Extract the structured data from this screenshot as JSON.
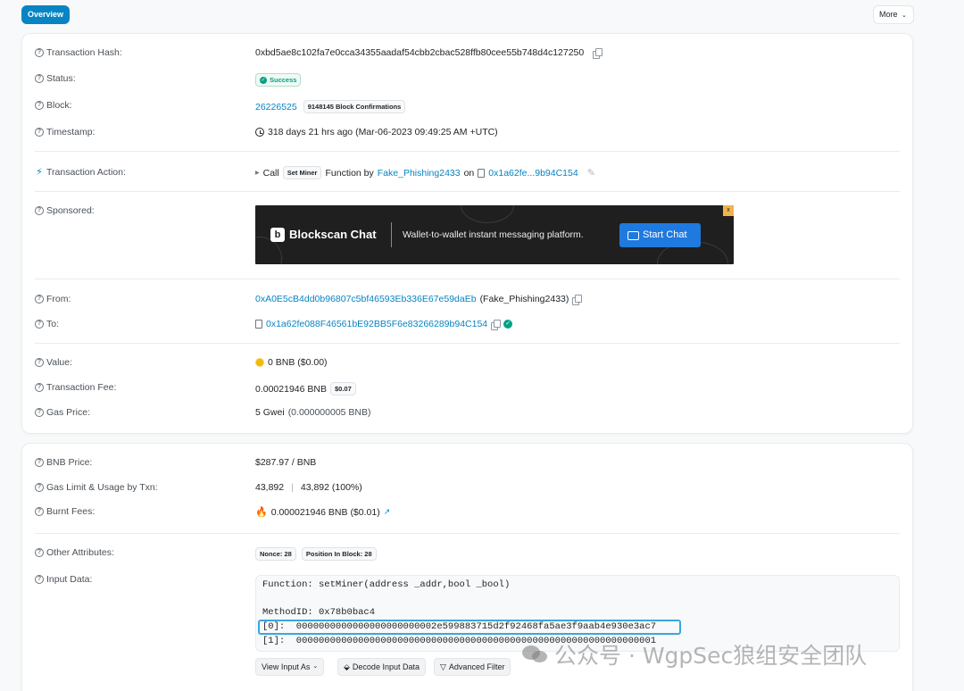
{
  "tabs": {
    "overview": "Overview",
    "more": "More"
  },
  "icons": {
    "question": "?",
    "check": "✓",
    "bolt": "⚡",
    "fire": "🔥",
    "external": "↗"
  },
  "card1": {
    "tx_hash_label": "Transaction Hash:",
    "tx_hash": "0xbd5ae8c102fa7e0cca34355aadaf54cbb2cbac528ffb80cee55b748d4c127250",
    "status_label": "Status:",
    "status": "Success",
    "block_label": "Block:",
    "block": "26226525",
    "confirmations": "9148145 Block Confirmations",
    "timestamp_label": "Timestamp:",
    "timestamp": "318 days 21 hrs ago (Mar-06-2023 09:49:25 AM +UTC)",
    "action_label": "Transaction Action:",
    "action_call": "Call",
    "action_method": "Set Miner",
    "action_function_by": "Function by",
    "action_caller": "Fake_Phishing2433",
    "action_on": "on",
    "action_contract": "0x1a62fe...9b94C154",
    "sponsored_label": "Sponsored:",
    "banner": {
      "brand_letter": "b",
      "brand": "Blockscan Chat",
      "tagline": "Wallet-to-wallet instant messaging platform.",
      "cta": "Start Chat",
      "adtag": "x"
    },
    "from_label": "From:",
    "from_address": "0xA0E5cB4dd0b96807c5bf46593Eb336E67e59daEb",
    "from_name": "(Fake_Phishing2433)",
    "to_label": "To:",
    "to_address": "0x1a62fe088F46561bE92BB5F6e83266289b94C154",
    "value_label": "Value:",
    "value": "0 BNB ($0.00)",
    "fee_label": "Transaction Fee:",
    "fee": "0.00021946 BNB",
    "fee_usd": "$0.07",
    "gas_price_label": "Gas Price:",
    "gas_price": "5 Gwei",
    "gas_price_bnb": "(0.000000005 BNB)"
  },
  "card2": {
    "bnb_price_label": "BNB Price:",
    "bnb_price": "$287.97 / BNB",
    "gas_limit_label": "Gas Limit & Usage by Txn:",
    "gas_limit": "43,892",
    "gas_usage": "43,892 (100%)",
    "burnt_label": "Burnt Fees:",
    "burnt": "0.000021946 BNB ($0.01)",
    "other_label": "Other Attributes:",
    "nonce": "Nonce: 28",
    "position": "Position In Block: 28",
    "input_label": "Input Data:",
    "input_lines": {
      "function": "Function: setMiner(address _addr,bool _bool)",
      "method_id": "MethodID: 0x78b0bac4",
      "param0": "[0]:  0000000000000000000000002e599883715d2f92468fa5ae3f9aab4e930e3ac7",
      "param1": "[1]:  0000000000000000000000000000000000000000000000000000000000000001"
    },
    "buttons": {
      "view_input": "View Input As",
      "decode": "Decode Input Data",
      "filter": "Advanced Filter"
    }
  },
  "watermark": "公众号 · WgpSec狼组安全团队"
}
